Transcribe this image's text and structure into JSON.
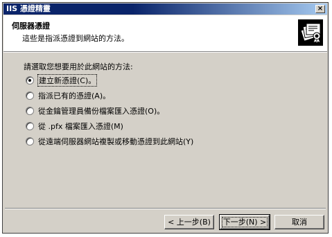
{
  "window": {
    "title": "IIS 憑證精靈",
    "close_glyph": "×"
  },
  "header": {
    "title": "伺服器憑證",
    "subtitle": "這些是指派憑證到網站的方法。",
    "icon": "certificate-icon"
  },
  "body": {
    "prompt": "請選取您想要用於此網站的方法:",
    "options": [
      {
        "label": "建立新憑證(C)。",
        "selected": true
      },
      {
        "label": "指派已有的憑證(A)。",
        "selected": false
      },
      {
        "label": "從金鑰管理員備份檔案匯入憑證(O)。",
        "selected": false
      },
      {
        "label": "從 .pfx 檔案匯入憑證(M)",
        "selected": false
      },
      {
        "label": "從遠端伺服器網站複製或移動憑證到此網站(Y)",
        "selected": false
      }
    ]
  },
  "buttons": {
    "back": "< 上一步(B)",
    "next": "下一步(N) >",
    "cancel": "取消"
  }
}
